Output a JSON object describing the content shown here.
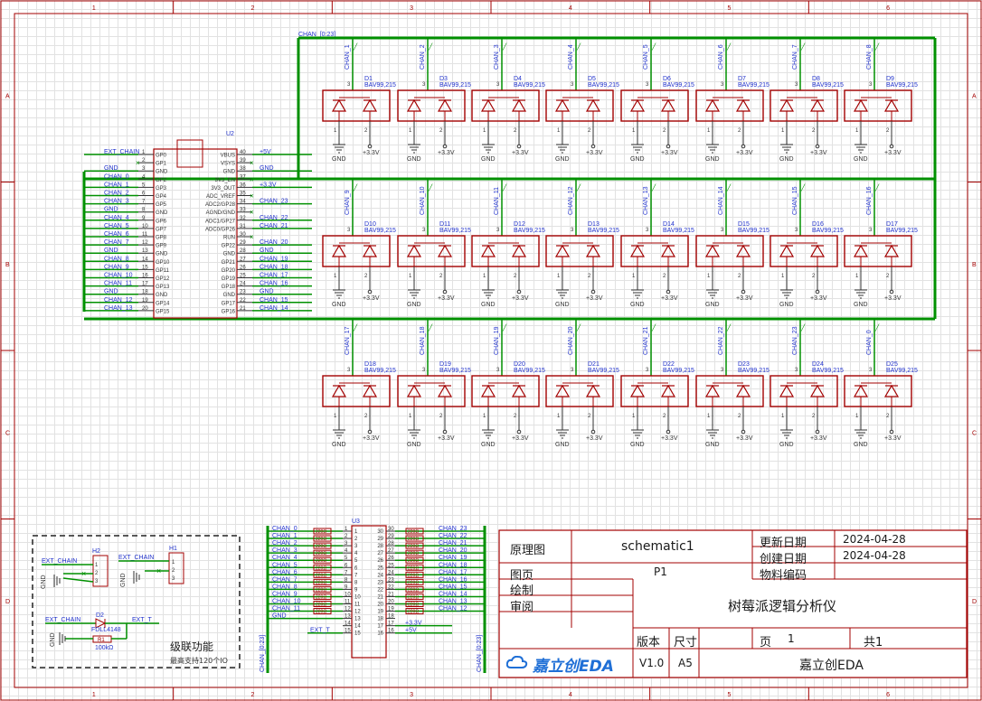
{
  "colors": {
    "frame": "#a30000",
    "wire": "#009000",
    "net": "#2233cc",
    "part": "#a30000",
    "label": "#2233cc",
    "pin": "#333333"
  },
  "frame": {
    "cols": [
      "1",
      "2",
      "3",
      "4",
      "5",
      "6"
    ],
    "rows": [
      "A",
      "B",
      "C",
      "D"
    ]
  },
  "bus_label": "CHAN_[0:23]",
  "diodes": {
    "part_value": "BAV99,215",
    "rows": [
      {
        "designators": [
          "D1",
          "D3",
          "D4",
          "D5",
          "D6",
          "D7",
          "D8",
          "D9"
        ],
        "nets": [
          "CHAN_1",
          "CHAN_2",
          "CHAN_3",
          "CHAN_4",
          "CHAN_5",
          "CHAN_6",
          "CHAN_7",
          "CHAN_8"
        ]
      },
      {
        "designators": [
          "D10",
          "D11",
          "D12",
          "D13",
          "D14",
          "D15",
          "D16",
          "D17"
        ],
        "nets": [
          "CHAN_9",
          "CHAN_10",
          "CHAN_11",
          "CHAN_12",
          "CHAN_13",
          "CHAN_14",
          "CHAN_15",
          "CHAN_16"
        ]
      },
      {
        "designators": [
          "D18",
          "D19",
          "D20",
          "D21",
          "D22",
          "D23",
          "D24",
          "D25"
        ],
        "nets": [
          "CHAN_17",
          "CHAN_18",
          "CHAN_19",
          "CHAN_20",
          "CHAN_21",
          "CHAN_22",
          "CHAN_23",
          "CHAN_0"
        ]
      }
    ],
    "gnd_label": "GND",
    "vcc_label": "+3.3V",
    "pin_labels": [
      "3",
      "1",
      "2"
    ]
  },
  "u2": {
    "designator": "U2",
    "left_pins": [
      {
        "num": "1",
        "name": "GP0",
        "net": "EXT_CHAIN"
      },
      {
        "num": "2",
        "name": "GP1",
        "net": ""
      },
      {
        "num": "3",
        "name": "GND",
        "net": "GND"
      },
      {
        "num": "4",
        "name": "GP2",
        "net": "CHAN_0"
      },
      {
        "num": "5",
        "name": "GP3",
        "net": "CHAN_1"
      },
      {
        "num": "6",
        "name": "GP4",
        "net": "CHAN_2"
      },
      {
        "num": "7",
        "name": "GP5",
        "net": "CHAN_3"
      },
      {
        "num": "8",
        "name": "GND",
        "net": "GND"
      },
      {
        "num": "9",
        "name": "GP6",
        "net": "CHAN_4"
      },
      {
        "num": "10",
        "name": "GP7",
        "net": "CHAN_5"
      },
      {
        "num": "11",
        "name": "GP8",
        "net": "CHAN_6"
      },
      {
        "num": "12",
        "name": "GP9",
        "net": "CHAN_7"
      },
      {
        "num": "13",
        "name": "GND",
        "net": "GND"
      },
      {
        "num": "14",
        "name": "GP10",
        "net": "CHAN_8"
      },
      {
        "num": "15",
        "name": "GP11",
        "net": "CHAN_9"
      },
      {
        "num": "16",
        "name": "GP12",
        "net": "CHAN_10"
      },
      {
        "num": "17",
        "name": "GP13",
        "net": "CHAN_11"
      },
      {
        "num": "18",
        "name": "GND",
        "net": "GND"
      },
      {
        "num": "19",
        "name": "GP14",
        "net": "CHAN_12"
      },
      {
        "num": "20",
        "name": "GP15",
        "net": "CHAN_13"
      }
    ],
    "right_pins": [
      {
        "num": "40",
        "name": "VBUS",
        "net": "+5V"
      },
      {
        "num": "39",
        "name": "VSYS",
        "net": ""
      },
      {
        "num": "38",
        "name": "GND",
        "net": "GND"
      },
      {
        "num": "37",
        "name": "3V3_EN",
        "net": ""
      },
      {
        "num": "36",
        "name": "3V3_OUT",
        "net": "+3.3V"
      },
      {
        "num": "35",
        "name": "ADC_VREF",
        "net": ""
      },
      {
        "num": "34",
        "name": "ADC2/GP28",
        "net": "CHAN_23"
      },
      {
        "num": "33",
        "name": "AGND/GND",
        "net": ""
      },
      {
        "num": "32",
        "name": "ADC1/GP27",
        "net": "CHAN_22"
      },
      {
        "num": "31",
        "name": "ADC0/GP26",
        "net": "CHAN_21"
      },
      {
        "num": "30",
        "name": "RUN",
        "net": ""
      },
      {
        "num": "29",
        "name": "GP22",
        "net": "CHAN_20"
      },
      {
        "num": "28",
        "name": "GND",
        "net": "GND"
      },
      {
        "num": "27",
        "name": "GP21",
        "net": "CHAN_19"
      },
      {
        "num": "26",
        "name": "GP20",
        "net": "CHAN_18"
      },
      {
        "num": "25",
        "name": "GP19",
        "net": "CHAN_17"
      },
      {
        "num": "24",
        "name": "GP18",
        "net": "CHAN_16"
      },
      {
        "num": "23",
        "name": "GND",
        "net": "GND"
      },
      {
        "num": "22",
        "name": "GP17",
        "net": "CHAN_15"
      },
      {
        "num": "21",
        "name": "GP16",
        "net": "CHAN_14"
      }
    ]
  },
  "u3": {
    "designator": "U3",
    "resistor_value": "220Ω",
    "left_nets": [
      "CHAN_0",
      "CHAN_1",
      "CHAN_2",
      "CHAN_3",
      "CHAN_4",
      "CHAN_5",
      "CHAN_6",
      "CHAN_7",
      "CHAN_8",
      "CHAN_9",
      "CHAN_10",
      "CHAN_11"
    ],
    "right_nets": [
      "CHAN_23",
      "CHAN_22",
      "CHAN_21",
      "CHAN_20",
      "CHAN_19",
      "CHAN_18",
      "CHAN_17",
      "CHAN_16",
      "CHAN_15",
      "CHAN_14",
      "CHAN_13",
      "CHAN_12"
    ],
    "left_pin_nums": [
      "1",
      "2",
      "3",
      "4",
      "5",
      "6",
      "7",
      "8",
      "9",
      "10",
      "11",
      "12",
      "13",
      "14",
      "15"
    ],
    "right_pin_nums": [
      "30",
      "29",
      "28",
      "27",
      "26",
      "25",
      "24",
      "23",
      "22",
      "21",
      "20",
      "19",
      "18",
      "17",
      "16"
    ],
    "bottom_left_nets": [
      "GND",
      "EXT_T"
    ],
    "bottom_right_nets": [
      "+3.3V",
      "+5V"
    ],
    "bus_left": "CHAN_[0:23]",
    "bus_right": "CHAN_[0:23]"
  },
  "cascade": {
    "title": "级联功能",
    "subtitle": "最高支持120个IO",
    "h2": "H2",
    "h1": "H1",
    "net_chain": "EXT_CHAIN",
    "gnd": "GND",
    "d2": "D2",
    "d2_value": "FDLL4148",
    "r1": "R1",
    "r1_value": "100kΩ",
    "ext_t": "EXT_T",
    "header_pins": [
      "1",
      "2",
      "3"
    ]
  },
  "title_block": {
    "schematic_label": "原理图",
    "schematic_value": "schematic1",
    "updated_label": "更新日期",
    "updated_value": "2024-04-28",
    "created_label": "创建日期",
    "created_value": "2024-04-28",
    "bom_label": "物料编码",
    "page_label": "图页",
    "page_value": "P1",
    "drawn_label": "绘制",
    "review_label": "审阅",
    "project_name": "树莓派逻辑分析仪",
    "version_label": "版本",
    "size_label": "尺寸",
    "version_value": "V1.0",
    "size_value": "A5",
    "sheet_label": "页",
    "sheet_no": "1",
    "total_label": "共1",
    "company": "嘉立创EDA",
    "logo_text": "嘉立创EDA"
  }
}
